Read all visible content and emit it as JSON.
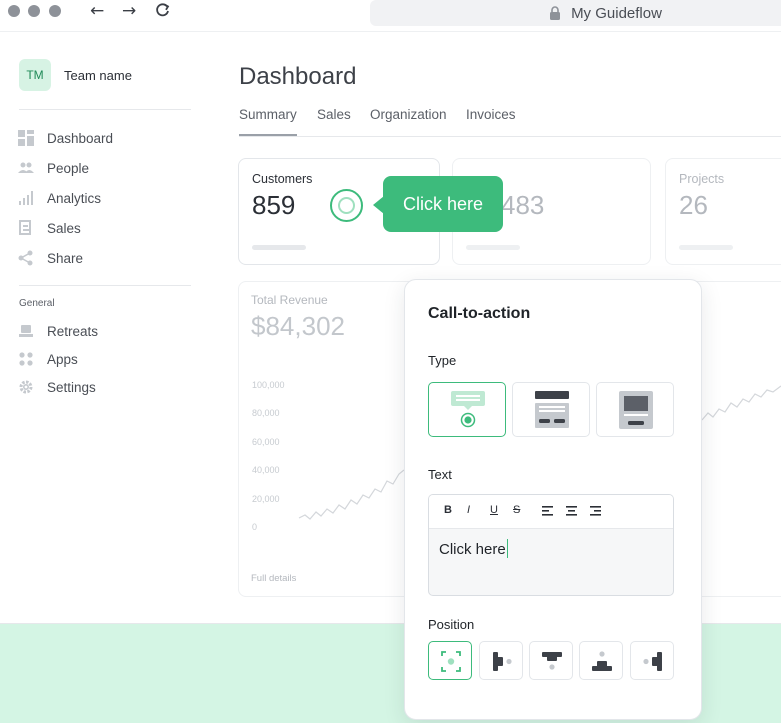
{
  "browser": {
    "url": "My Guideflow",
    "back": "←",
    "forward": "→",
    "reload": "C"
  },
  "sidebar": {
    "team_initials": "TM",
    "team_name": "Team name",
    "items": [
      {
        "label": "Dashboard",
        "icon": "dashboard-icon"
      },
      {
        "label": "People",
        "icon": "people-icon"
      },
      {
        "label": "Analytics",
        "icon": "analytics-icon"
      },
      {
        "label": "Sales",
        "icon": "sales-icon"
      },
      {
        "label": "Share",
        "icon": "share-icon"
      }
    ],
    "group_label": "General",
    "general_items": [
      {
        "label": "Retreats",
        "icon": "retreats-icon"
      },
      {
        "label": "Apps",
        "icon": "apps-icon"
      },
      {
        "label": "Settings",
        "icon": "gear-icon"
      }
    ]
  },
  "main": {
    "title": "Dashboard",
    "tabs": [
      "Summary",
      "Sales",
      "Organization",
      "Invoices"
    ],
    "active_tab": "Summary",
    "cards": [
      {
        "label": "Customers",
        "value": "859"
      },
      {
        "label": "",
        "value": "483"
      },
      {
        "label": "Projects",
        "value": "26"
      }
    ],
    "revenue": {
      "label": "Total Revenue",
      "value": "$84,302",
      "link": "Full details"
    }
  },
  "chart_data": {
    "type": "line",
    "yticks": [
      "100,000",
      "80,000",
      "60,000",
      "40,000",
      "20,000",
      "0"
    ],
    "ylim": [
      0,
      100000
    ]
  },
  "hotspot": {
    "bubble_text": "Click here"
  },
  "panel": {
    "title": "Call-to-action",
    "type_label": "Type",
    "text_label": "Text",
    "toolbar": {
      "bold": "B",
      "italic": "I",
      "underline": "U",
      "strike": "S"
    },
    "text_value": "Click here",
    "position_label": "Position"
  },
  "colors": {
    "accent": "#3dbb7c",
    "accent_light": "#d4f5e4"
  }
}
